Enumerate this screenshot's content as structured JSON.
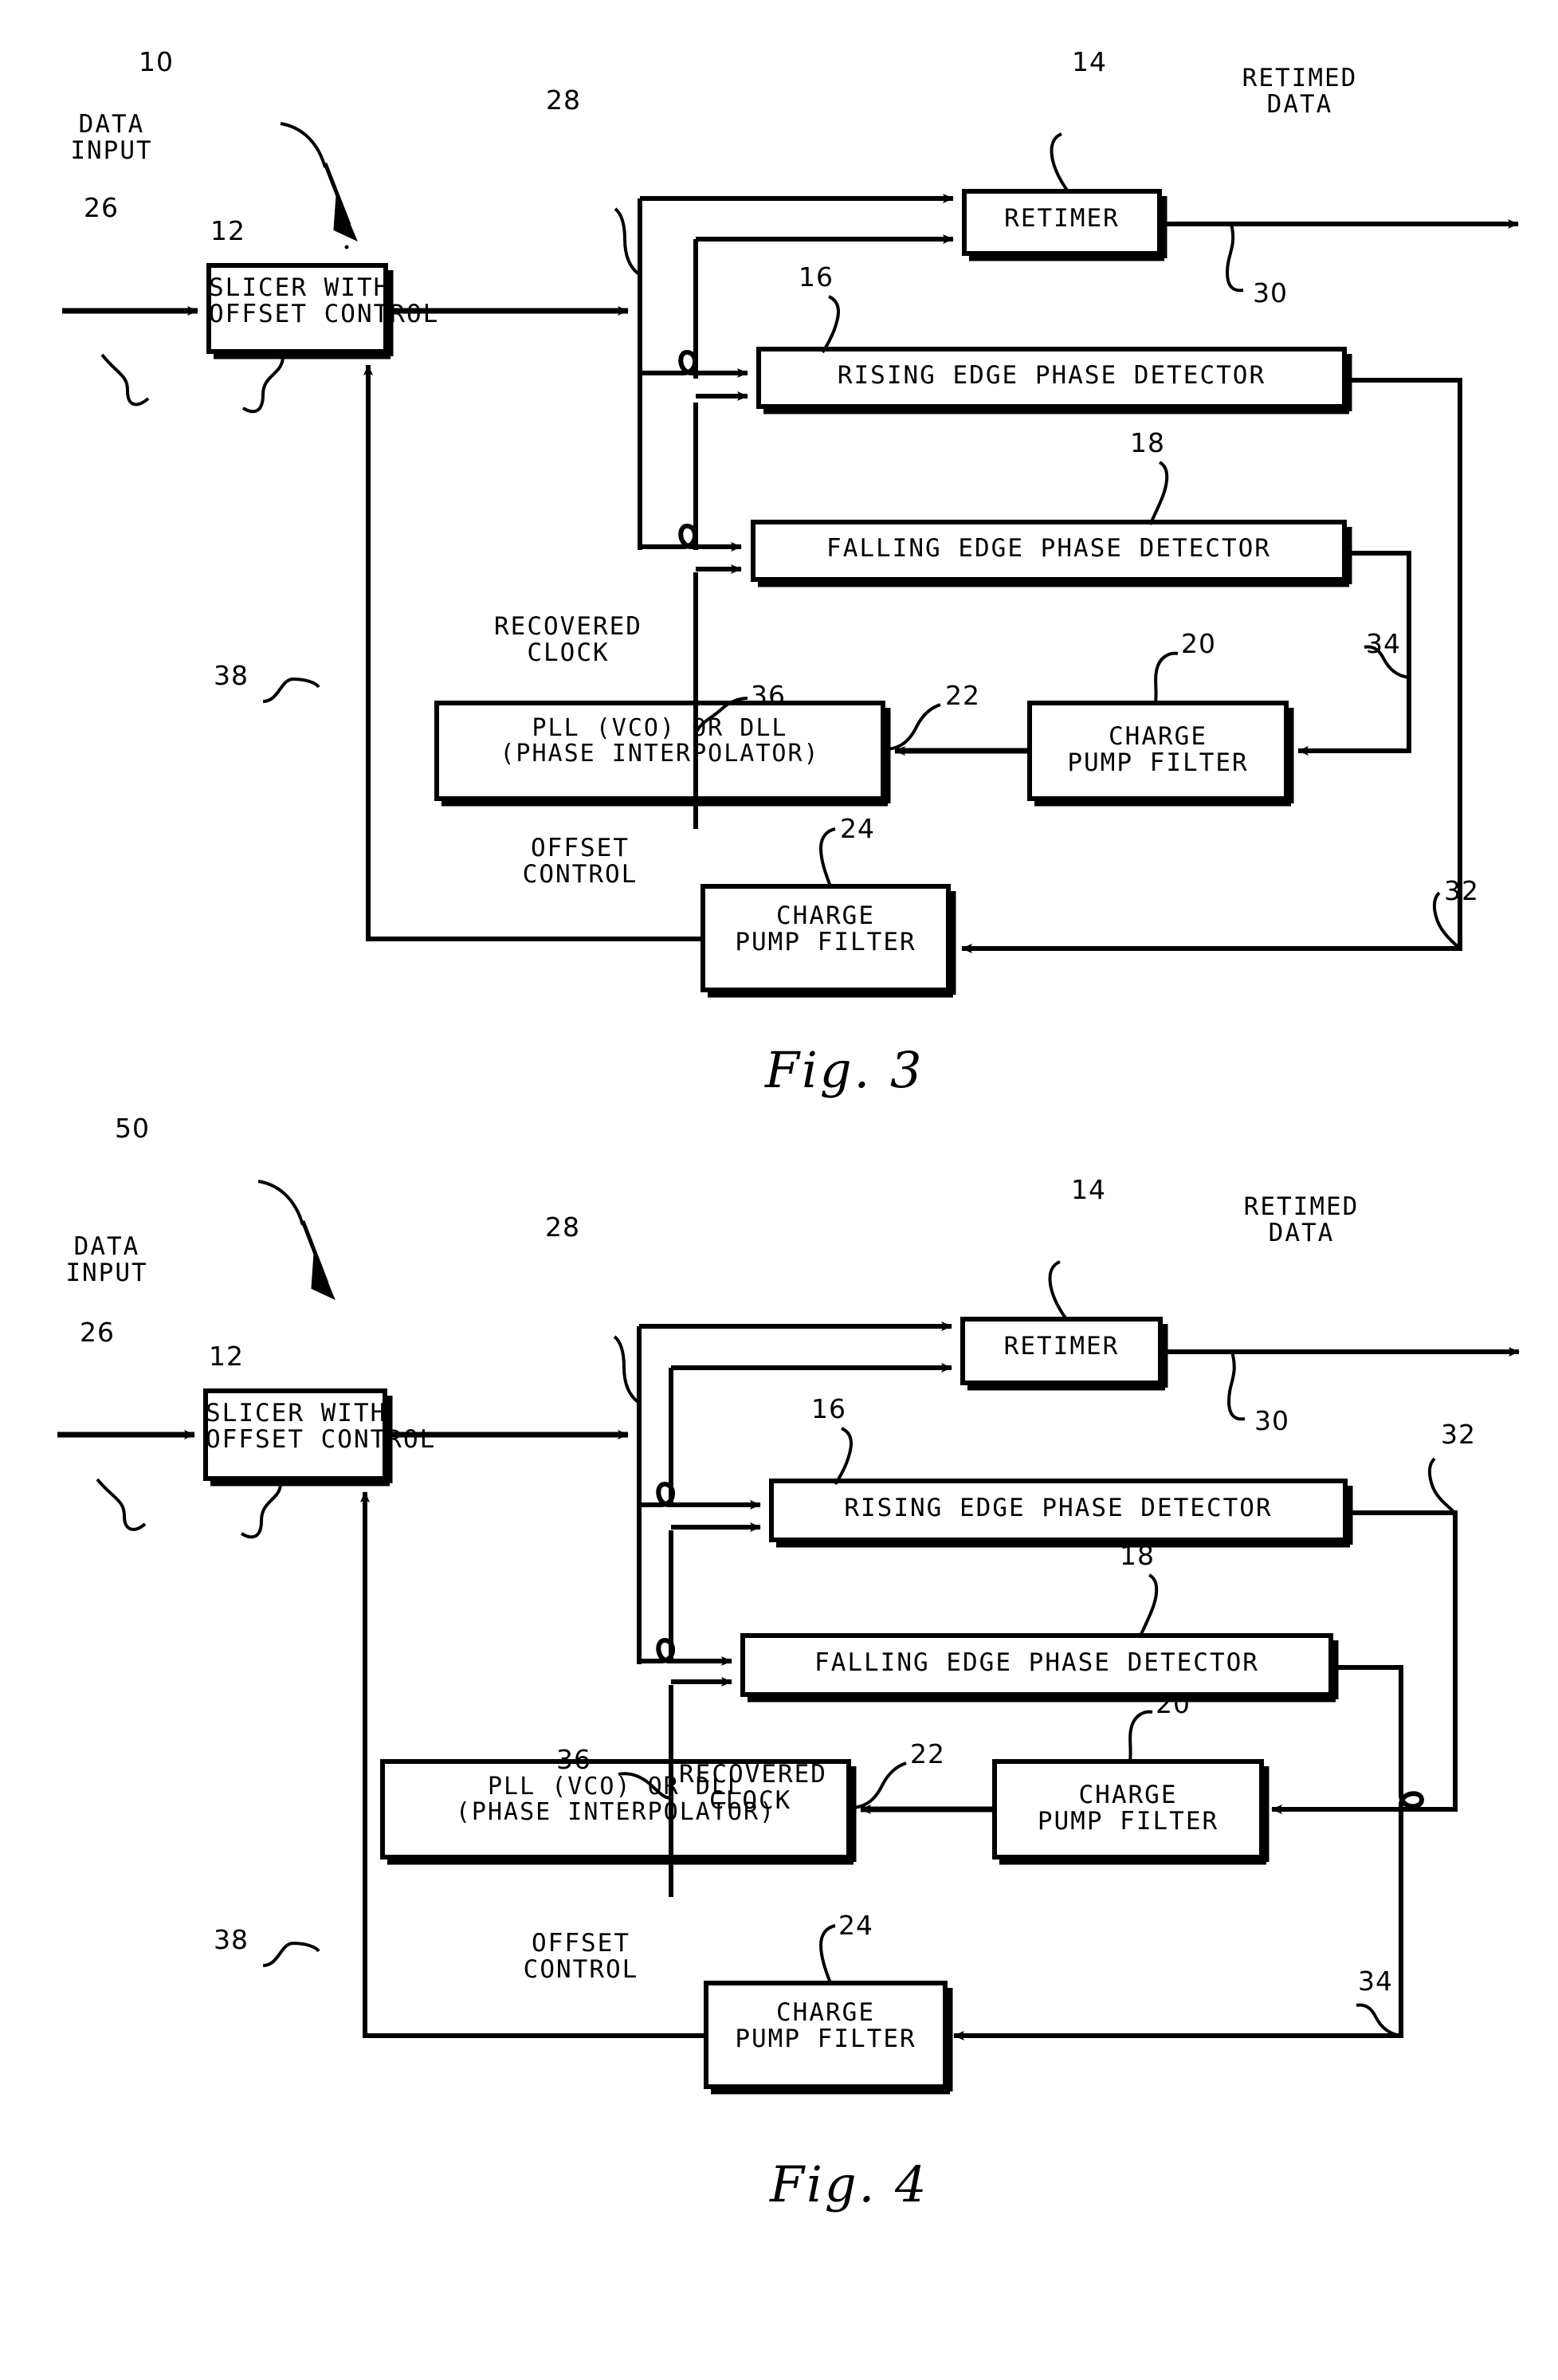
{
  "document": {
    "type": "patent-drawing-sheet",
    "figures": [
      "Fig. 3",
      "Fig. 4"
    ]
  },
  "fig3": {
    "caption": "Fig. 3",
    "system_ref": "10",
    "blocks": {
      "slicer": {
        "line1": "SLICER WITH",
        "line2": "OFFSET CONTROL",
        "ref": "12"
      },
      "retimer": {
        "line1": "RETIMER",
        "ref": "14"
      },
      "rising": {
        "line1": "RISING EDGE PHASE DETECTOR",
        "ref": "16"
      },
      "falling": {
        "line1": "FALLING EDGE PHASE DETECTOR",
        "ref": "18"
      },
      "pll": {
        "line1": "PLL (VCO) OR DLL",
        "line2": "(PHASE INTERPOLATOR)",
        "ref": "22"
      },
      "charge_pump_clock": {
        "line1": "CHARGE",
        "line2": "PUMP FILTER",
        "ref": "20"
      },
      "charge_pump_offset": {
        "line1": "CHARGE",
        "line2": "PUMP FILTER",
        "ref": "24"
      }
    },
    "signals": {
      "data_input": {
        "line1": "DATA",
        "line2": "INPUT",
        "ref": "26"
      },
      "sliced_data": {
        "ref": "28"
      },
      "retimed_data": {
        "line1": "RETIMED",
        "line2": "DATA",
        "ref": "30"
      },
      "recovered_clock": {
        "line1": "RECOVERED",
        "line2": "CLOCK",
        "ref": "36"
      },
      "offset_control": {
        "line1": "OFFSET",
        "line2": "CONTROL",
        "ref": "38"
      },
      "rising_out": {
        "ref": "32"
      },
      "falling_out": {
        "ref": "34"
      }
    }
  },
  "fig4": {
    "caption": "Fig. 4",
    "system_ref": "50",
    "blocks": {
      "slicer": {
        "line1": "SLICER WITH",
        "line2": "OFFSET CONTROL",
        "ref": "12"
      },
      "retimer": {
        "line1": "RETIMER",
        "ref": "14"
      },
      "rising": {
        "line1": "RISING EDGE PHASE DETECTOR",
        "ref": "16"
      },
      "falling": {
        "line1": "FALLING EDGE PHASE DETECTOR",
        "ref": "18"
      },
      "pll": {
        "line1": "PLL (VCO) OR DLL",
        "line2": "(PHASE INTERPOLATOR)",
        "ref": "22"
      },
      "charge_pump_clock": {
        "line1": "CHARGE",
        "line2": "PUMP FILTER",
        "ref": "20"
      },
      "charge_pump_offset": {
        "line1": "CHARGE",
        "line2": "PUMP FILTER",
        "ref": "24"
      }
    },
    "signals": {
      "data_input": {
        "line1": "DATA",
        "line2": "INPUT",
        "ref": "26"
      },
      "sliced_data": {
        "ref": "28"
      },
      "retimed_data": {
        "line1": "RETIMED",
        "line2": "DATA",
        "ref": "30"
      },
      "recovered_clock": {
        "line1": "RECOVERED",
        "line2": "CLOCK",
        "ref": "36"
      },
      "offset_control": {
        "line1": "OFFSET",
        "line2": "CONTROL",
        "ref": "38"
      },
      "rising_out": {
        "ref": "32"
      },
      "falling_out": {
        "ref": "34"
      }
    }
  },
  "colors": {
    "ink": "#000000",
    "paper": "#ffffff"
  }
}
